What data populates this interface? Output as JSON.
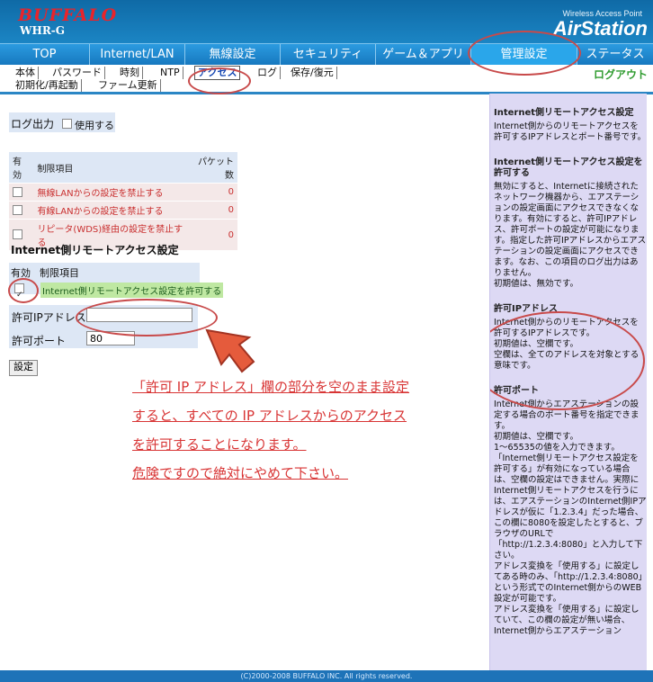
{
  "header": {
    "brand": "BUFFALO",
    "model": "WHR-G",
    "wireless": "Wireless Access Point",
    "product": "AirStation"
  },
  "nav": [
    {
      "label": "TOP"
    },
    {
      "label": "Internet/LAN"
    },
    {
      "label": "無線設定"
    },
    {
      "label": "セキュリティ"
    },
    {
      "label": "ゲーム＆アプリ"
    },
    {
      "label": "管理設定"
    },
    {
      "label": "ステータス"
    }
  ],
  "subnav": [
    {
      "label": "本体"
    },
    {
      "label": "パスワード"
    },
    {
      "label": "時刻"
    },
    {
      "label": "NTP"
    },
    {
      "label": "アクセス"
    },
    {
      "label": "ログ"
    },
    {
      "label": "保存/復元"
    },
    {
      "label": "初期化/再起動"
    },
    {
      "label": "ファーム更新"
    }
  ],
  "logout": "ログアウト",
  "logoutput": {
    "label": "ログ出力",
    "use": "使用する"
  },
  "restrictions": {
    "headers": [
      "有効",
      "制限項目",
      "パケット数"
    ],
    "rows": [
      {
        "text": "無線LANからの設定を禁止する",
        "count": "0"
      },
      {
        "text": "有線LANからの設定を禁止する",
        "count": "0"
      },
      {
        "text": "リピータ(WDS)経由の設定を禁止する",
        "count": "0"
      }
    ]
  },
  "remote": {
    "title": "Internet側リモートアクセス設定",
    "headers": [
      "有効",
      "制限項目"
    ],
    "allow": "Internet側リモートアクセス設定を許可する",
    "ip_label": "許可IPアドレス",
    "ip_value": "",
    "port_label": "許可ポート",
    "port_value": "80",
    "submit": "設定"
  },
  "note": [
    "「許可 IP アドレス」欄の部分を空のまま設定",
    "すると、すべての IP アドレスからのアクセス",
    "を許可することになります。",
    "危険ですので絶対にやめて下さい。"
  ],
  "side": [
    {
      "title": "Internet側リモートアクセス設定",
      "text": "Internet側からのリモートアクセスを許可するIPアドレスとポート番号です。"
    },
    {
      "title": "Internet側リモートアクセス設定を許可する",
      "text": "無効にすると、Internetに接続されたネットワーク機器から、エアステーションの設定画面にアクセスできなくなります。有効にすると、許可IPアドレス、許可ポートの設定が可能になります。指定した許可IPアドレスからエアステーションの設定画面にアクセスできます。なお、この項目のログ出力はありません。\n初期値は、無効です。"
    },
    {
      "title": "許可IPアドレス",
      "text": "Internet側からのリモートアクセスを許可するIPアドレスです。\n初期値は、空欄です。\n空欄は、全てのアドレスを対象とする意味です。"
    },
    {
      "title": "許可ポート",
      "text": "Internet側からエアステーションの設定する場合のポート番号を指定できます。\n初期値は、空欄です。\n1〜65535の値を入力できます。\n「Internet側リモートアクセス設定を許可する」が有効になっている場合は、空欄の設定はできません。実際にInternet側リモートアクセスを行うには、エアステーションのInternet側IPアドレスが仮に「1.2.3.4」だった場合、この欄に8080を設定したとすると、ブラウザのURLで「http://1.2.3.4:8080」と入力して下さい。\nアドレス変換を「使用する」に設定してある時のみ、「http://1.2.3.4:8080」という形式でのInternet側からのWEB設定が可能です。\nアドレス変換を「使用する」に設定していて、この欄の設定が無い場合、Internet側からエアステーション"
    }
  ],
  "footer": "(C)2000-2008 BUFFALO INC. All rights reserved."
}
